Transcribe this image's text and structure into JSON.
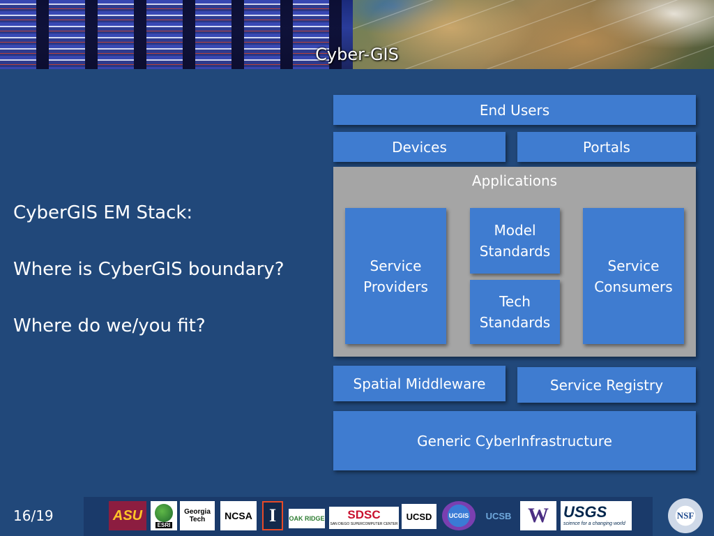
{
  "slide": {
    "title": "Cyber-GIS",
    "page_number": "16/19"
  },
  "left_text": {
    "line1": "CyberGIS EM Stack:",
    "line2": "Where is CyberGIS boundary?",
    "line3": "Where do we/you fit?"
  },
  "stack": {
    "end_users": "End Users",
    "devices": "Devices",
    "portals": "Portals",
    "applications": "Applications",
    "service_providers": "Service Providers",
    "model_standards": "Model Standards",
    "tech_standards": "Tech Standards",
    "service_consumers": "Service Consumers",
    "spatial_middleware": "Spatial Middleware",
    "service_registry": "Service Registry",
    "generic_ci": "Generic CyberInfrastructure"
  },
  "logos": {
    "asu": "ASU",
    "esri": "ESRI",
    "georgia_tech": "Georgia Tech",
    "ncsa": "NCSA",
    "illinois": "I",
    "oak_ridge": "OAK RIDGE",
    "sdsc": "SDSC",
    "sdsc_sub": "SAN DIEGO SUPERCOMPUTER CENTER",
    "ucsd": "UCSD",
    "ucgis": "UCGIS",
    "ucsb": "UCSB",
    "uw": "W",
    "usgs": "USGS",
    "usgs_sub": "science for a changing world",
    "nsf": "NSF"
  },
  "colors": {
    "background": "#21487a",
    "box_blue": "#3f7cd0",
    "applications_panel": "#a5a5a5"
  }
}
